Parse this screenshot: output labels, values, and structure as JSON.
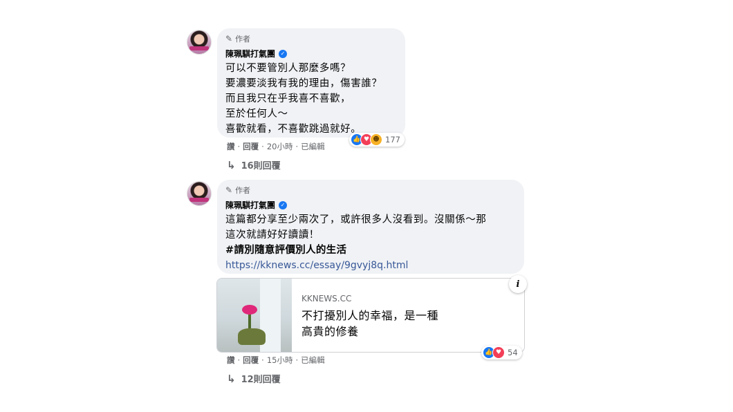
{
  "comments": [
    {
      "author_badge": "作者",
      "author_name": "陳珮騏打氣團",
      "text": "可以不要管別人那麼多嗎？\n要濃要淡我有我的理由，傷害誰？\n而且我只在乎我喜不喜歡，\n至於任何人～\n喜歡就看，不喜歡跳過就好。",
      "actions": {
        "like": "讚",
        "reply": "回覆",
        "time": "20小時",
        "edited": "已編輯"
      },
      "reaction_count": "177",
      "replies_label": "16則回覆"
    },
    {
      "author_badge": "作者",
      "author_name": "陳珮騏打氣團",
      "text": "這篇都分享至少兩次了，或許很多人沒看到。沒關係～那\n這次就請好好讀讀！",
      "hashtag": "#請別隨意評價別人的生活",
      "link": "https://kknews.cc/essay/9gvyj8q.html",
      "card": {
        "site": "KKNEWS.CC",
        "title": "不打擾別人的幸福，是一種高貴的修養"
      },
      "actions": {
        "like": "讚",
        "reply": "回覆",
        "time": "15小時",
        "edited": "已編輯"
      },
      "reaction_count": "54",
      "replies_label": "12則回覆"
    }
  ],
  "icons": {
    "author": "pencil-icon",
    "verified": "verified-check-icon",
    "info": "info-icon",
    "reply_arrow": "reply-arrow-icon"
  },
  "colors": {
    "bubble": "#f0f2f5",
    "link": "#385898",
    "verified": "#1877f2",
    "like": "#1877f2",
    "love": "#f33e58",
    "haha": "#f7b125"
  }
}
